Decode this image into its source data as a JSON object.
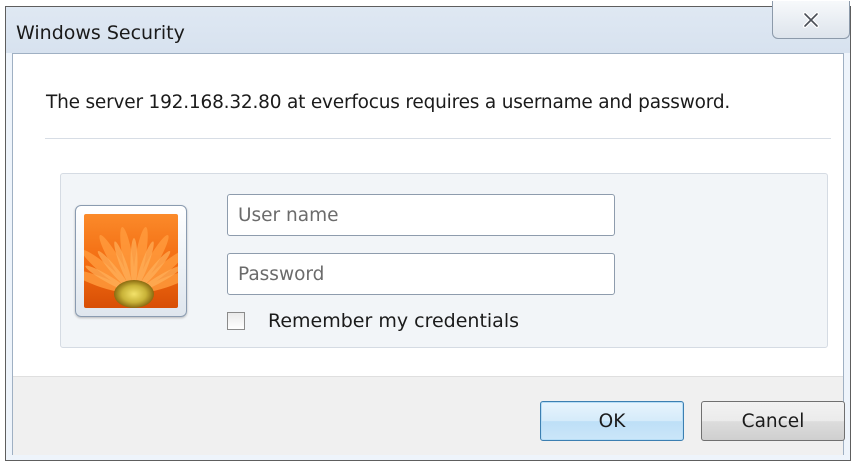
{
  "window": {
    "title": "Windows Security"
  },
  "dialog": {
    "message": "The server 192.168.32.80 at everfocus requires a username and password.",
    "username_placeholder": "User name",
    "password_placeholder": "Password",
    "remember_label": "Remember my credentials",
    "remember_checked": false,
    "ok_label": "OK",
    "cancel_label": "Cancel"
  },
  "icons": {
    "close": "close-x-icon",
    "avatar": "flower-user-tile-icon"
  },
  "colors": {
    "accent_border": "#3c7fb1",
    "title_bar": "#dfe8f3",
    "button_strip": "#f0f0f0"
  }
}
